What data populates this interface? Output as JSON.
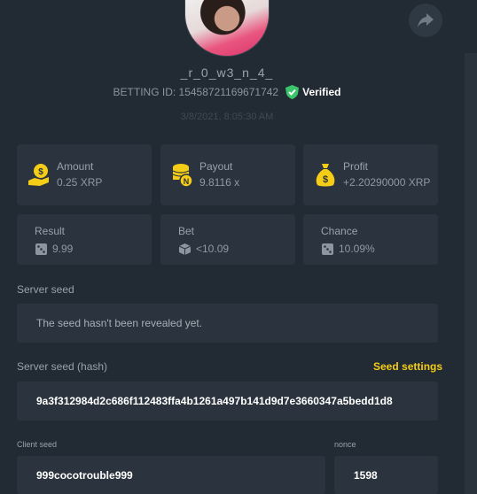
{
  "header": {
    "username": "_r_0_w3_n_4_",
    "betting_id": "BETTING ID: 15458721169671742",
    "verified_label": "Verified",
    "timestamp": "3/8/2021, 8:05:30 AM"
  },
  "stats": {
    "amount": {
      "label": "Amount",
      "value": "0.25 XRP"
    },
    "payout": {
      "label": "Payout",
      "value": "9.8116 x"
    },
    "profit": {
      "label": "Profit",
      "value": "+2.20290000 XRP"
    },
    "result": {
      "label": "Result",
      "value": "9.99"
    },
    "bet": {
      "label": "Bet",
      "value": "<10.09"
    },
    "chance": {
      "label": "Chance",
      "value": "10.09%"
    }
  },
  "server_seed": {
    "label": "Server seed",
    "value": "The seed hasn't been revealed yet."
  },
  "server_seed_hash": {
    "label": "Server seed (hash)",
    "settings_link": "Seed settings",
    "value": "9a3f312984d2c686f112483ffa4b1261a497b141d9d7e3660347a5bedd1d8"
  },
  "client_seed": {
    "label": "Client seed",
    "value": "999cocotrouble999"
  },
  "nonce": {
    "label": "nonce",
    "value": "1598"
  },
  "colors": {
    "accent": "#f5cc16",
    "verified": "#3ac56a",
    "background": "#222a33",
    "card": "#2b343e"
  },
  "icons": [
    "share-icon",
    "verified-check-icon",
    "hand-coin-icon",
    "coin-stack-icon",
    "money-bag-icon",
    "dice-icon"
  ]
}
